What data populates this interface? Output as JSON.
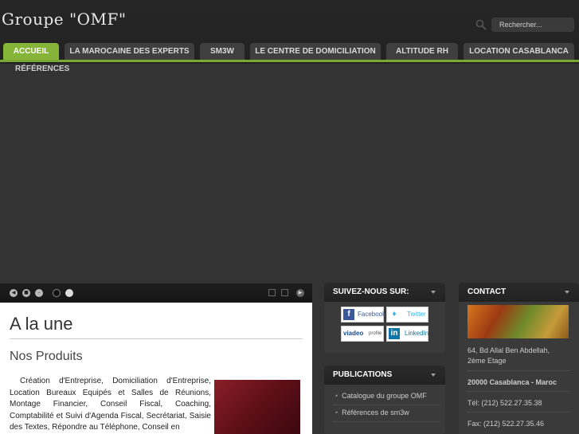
{
  "header": {
    "logo": "Groupe \"OMF\"",
    "search": {
      "placeholder": "Rechercher...",
      "icon": "magnifier-icon"
    }
  },
  "nav": {
    "tabs": [
      {
        "label": "ACCUEIL",
        "active": true
      },
      {
        "label": "LA MAROCAINE DES EXPERTS"
      },
      {
        "label": "SM3W"
      },
      {
        "label": "LE CENTRE DE DOMICILIATION"
      },
      {
        "label": "ALTITUDE RH"
      },
      {
        "label": "LOCATION CASABLANCA"
      },
      {
        "label": "RÉFÉRENCES"
      }
    ],
    "accent_color": "#85b439"
  },
  "main": {
    "headline": "A la une",
    "subheading": "Nos Produits",
    "paragraph": "Création d'Entreprise, Domiciliation d'Entreprise, Location Bureaux Equipés et Salles de Réunions, Montage Financier, Conseil Fiscal, Coaching, Comptabilité et Suivi d'Agenda Fiscal, Secrétariat, Saisie des Textes, Répondre au Téléphone, Conseil en"
  },
  "social": {
    "title": "SUIVEZ-NOUS SUR:",
    "links": [
      "Facebook",
      "Twitter",
      "viadeo",
      "profile",
      "LinkedIn"
    ]
  },
  "publications": {
    "title": "PUBLICATIONS",
    "items": [
      "Catalogue du groupe OMF",
      "Références de sm3w"
    ]
  },
  "contact": {
    "title": "CONTACT",
    "address_line1": "64, Bd Allal Ben Abdellah,",
    "address_line2": "2ème Etage",
    "city": "20000 Casablanca - Maroc",
    "tel": "Tél: (212) 522.27.35.38",
    "fax": "Fax: (212) 522.27.35.46"
  }
}
